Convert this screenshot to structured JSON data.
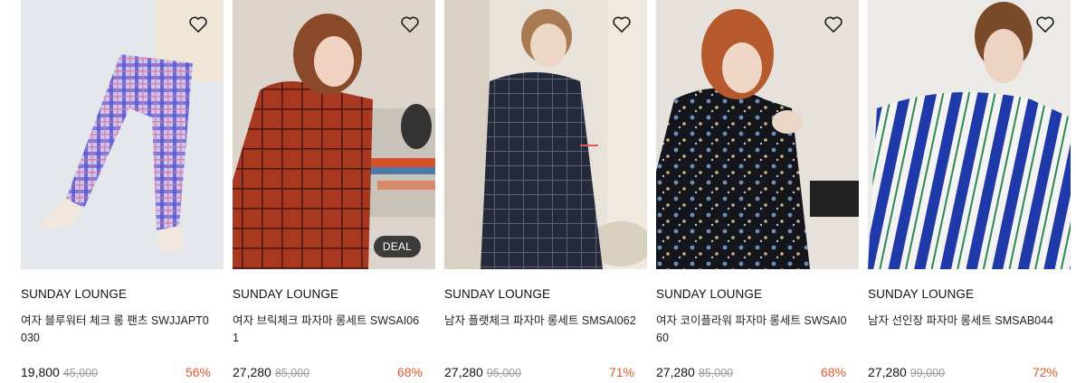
{
  "colors": {
    "discount": "#e4572e",
    "deal_badge_bg": "#3b3b3b"
  },
  "wishlist_icon": "heart-outline-icon",
  "products": [
    {
      "image_alt": "blue plaid pants",
      "brand": "SUNDAY LOUNGE",
      "title": "여자 블루워터 체크 롱 팬츠 SWJJAPT0030",
      "price": "19,800",
      "original_price": "45,000",
      "discount": "56%",
      "badge": ""
    },
    {
      "image_alt": "red check pajama set",
      "brand": "SUNDAY LOUNGE",
      "title": "여자 브릭체크 파자마 롱세트 SWSAI061",
      "price": "27,280",
      "original_price": "85,000",
      "discount": "68%",
      "badge": "DEAL"
    },
    {
      "image_alt": "navy check pajama set",
      "brand": "SUNDAY LOUNGE",
      "title": "남자 플랫체크 파자마 롱세트 SMSAI062",
      "price": "27,280",
      "original_price": "95,000",
      "discount": "71%",
      "badge": ""
    },
    {
      "image_alt": "floral pajama set",
      "brand": "SUNDAY LOUNGE",
      "title": "여자 코이플라워 파자마 롱세트 SWSAI060",
      "price": "27,280",
      "original_price": "85,000",
      "discount": "68%",
      "badge": ""
    },
    {
      "image_alt": "cactus stripe pajama set",
      "brand": "SUNDAY LOUNGE",
      "title": "남자 선인장 파자마 롱세트 SMSAB044",
      "price": "27,280",
      "original_price": "99,000",
      "discount": "72%",
      "badge": ""
    }
  ]
}
